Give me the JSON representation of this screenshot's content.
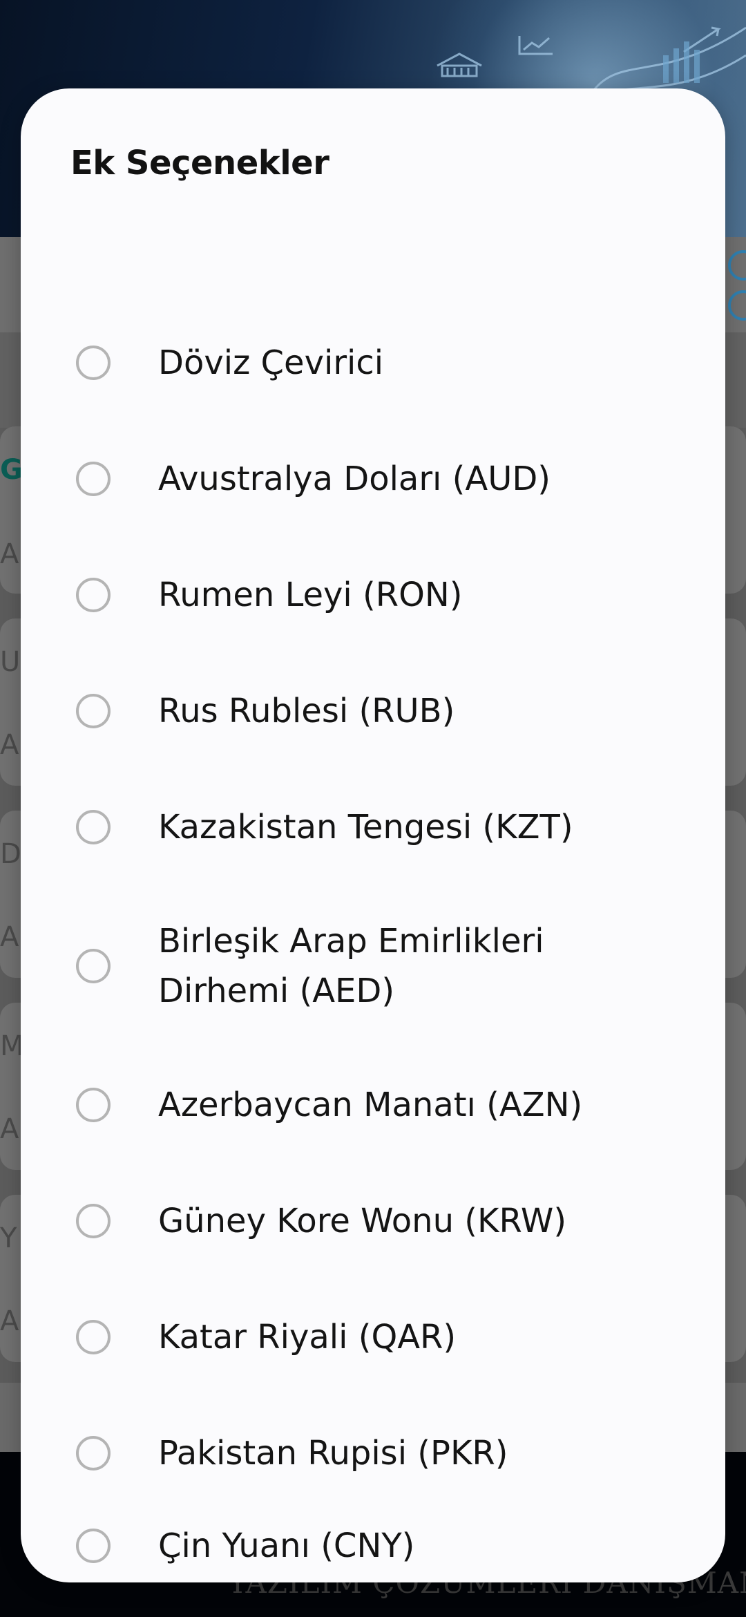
{
  "dialog": {
    "title": "Ek Seçenekler",
    "options": [
      {
        "label": "Döviz Çevirici",
        "selected": false
      },
      {
        "label": "Avustralya Doları (AUD)",
        "selected": false
      },
      {
        "label": "Rumen Leyi (RON)",
        "selected": false
      },
      {
        "label": "Rus Rublesi (RUB)",
        "selected": false
      },
      {
        "label": "Kazakistan Tengesi (KZT)",
        "selected": false
      },
      {
        "label": "Birleşik Arap Emirlikleri Dirhemi (AED)",
        "selected": false
      },
      {
        "label": "Azerbaycan Manatı (AZN)",
        "selected": false
      },
      {
        "label": "Güney Kore Wonu (KRW)",
        "selected": false
      },
      {
        "label": "Katar Riyali (QAR)",
        "selected": false
      },
      {
        "label": "Pakistan Rupisi (PKR)",
        "selected": false
      },
      {
        "label": "Çin Yuanı (CNY)",
        "selected": false
      }
    ]
  },
  "background": {
    "list_initials": [
      "G",
      "A",
      "U",
      "A",
      "D",
      "A",
      "M",
      "A",
      "Y",
      "A"
    ],
    "footer_brand": "YAZILIM ÇÖZÜMLERİ DANIŞMANI"
  },
  "colors": {
    "dialog_bg": "#fbfbfd",
    "radio_border": "#b4b4b4",
    "text": "#141414",
    "accent": "#0b5e55",
    "scrim": "#7a7a7a"
  }
}
